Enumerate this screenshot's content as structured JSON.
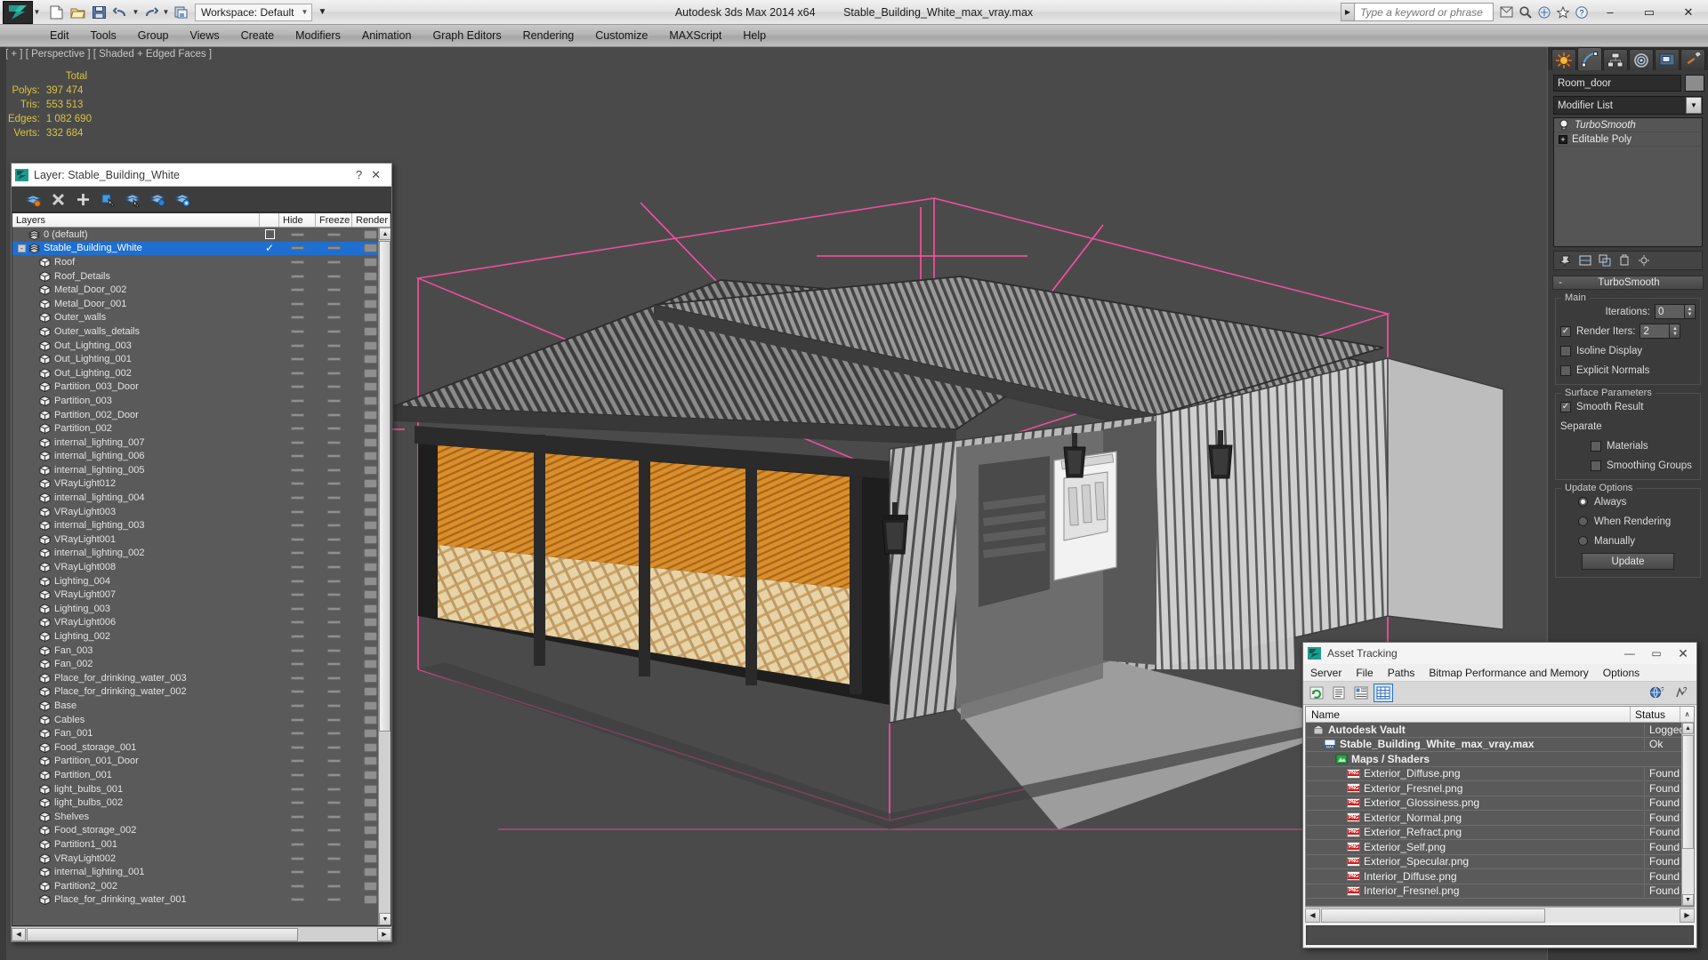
{
  "app": {
    "title": "Autodesk 3ds Max  2014 x64",
    "file": "Stable_Building_White_max_vray.max",
    "workspace": "Workspace: Default",
    "search_placeholder": "Type a keyword or phrase"
  },
  "menu": [
    "Edit",
    "Tools",
    "Group",
    "Views",
    "Create",
    "Modifiers",
    "Animation",
    "Graph Editors",
    "Rendering",
    "Customize",
    "MAXScript",
    "Help"
  ],
  "window_buttons": {
    "minimize": "–",
    "maximize": "▭",
    "close": "✕"
  },
  "viewport": {
    "label": "[ + ] [ Perspective ] [ Shaded + Edged Faces ]",
    "stats_header": "Total",
    "stats": [
      {
        "label": "Polys:",
        "value": "397 474"
      },
      {
        "label": "Tris:",
        "value": "553 513"
      },
      {
        "label": "Edges:",
        "value": "1 082 690"
      },
      {
        "label": "Verts:",
        "value": "332 684"
      }
    ]
  },
  "layer_dialog": {
    "title": "Layer: Stable_Building_White",
    "help_glyph": "?",
    "close_glyph": "✕",
    "toolbar": [
      "delete-layer-icon",
      "remove-layer-icon",
      "new-layer-icon",
      "select-objects-icon",
      "add-selection-icon",
      "select-highlight-icon",
      "layer-properties-icon"
    ],
    "columns": [
      "Layers",
      "",
      "Hide",
      "Freeze",
      "Render"
    ],
    "rows": [
      {
        "name": "0 (default)",
        "indent": 1,
        "type": "layer",
        "checkbox": "empty"
      },
      {
        "name": "Stable_Building_White",
        "indent": 0,
        "type": "layer",
        "checkbox": "tick",
        "selected": true,
        "expander": "-"
      },
      {
        "name": "Roof",
        "indent": 2,
        "type": "object"
      },
      {
        "name": "Roof_Details",
        "indent": 2,
        "type": "object"
      },
      {
        "name": "Metal_Door_002",
        "indent": 2,
        "type": "object"
      },
      {
        "name": "Metal_Door_001",
        "indent": 2,
        "type": "object"
      },
      {
        "name": "Outer_walls",
        "indent": 2,
        "type": "object"
      },
      {
        "name": "Outer_walls_details",
        "indent": 2,
        "type": "object"
      },
      {
        "name": "Out_Lighting_003",
        "indent": 2,
        "type": "object"
      },
      {
        "name": "Out_Lighting_001",
        "indent": 2,
        "type": "object"
      },
      {
        "name": "Out_Lighting_002",
        "indent": 2,
        "type": "object"
      },
      {
        "name": "Partition_003_Door",
        "indent": 2,
        "type": "object"
      },
      {
        "name": "Partition_003",
        "indent": 2,
        "type": "object"
      },
      {
        "name": "Partition_002_Door",
        "indent": 2,
        "type": "object"
      },
      {
        "name": "Partition_002",
        "indent": 2,
        "type": "object"
      },
      {
        "name": "internal_lighting_007",
        "indent": 2,
        "type": "object"
      },
      {
        "name": "internal_lighting_006",
        "indent": 2,
        "type": "object"
      },
      {
        "name": "internal_lighting_005",
        "indent": 2,
        "type": "object"
      },
      {
        "name": "VRayLight012",
        "indent": 2,
        "type": "object"
      },
      {
        "name": "internal_lighting_004",
        "indent": 2,
        "type": "object"
      },
      {
        "name": "VRayLight003",
        "indent": 2,
        "type": "object"
      },
      {
        "name": "internal_lighting_003",
        "indent": 2,
        "type": "object"
      },
      {
        "name": "VRayLight001",
        "indent": 2,
        "type": "object"
      },
      {
        "name": "internal_lighting_002",
        "indent": 2,
        "type": "object"
      },
      {
        "name": "VRayLight008",
        "indent": 2,
        "type": "object"
      },
      {
        "name": "Lighting_004",
        "indent": 2,
        "type": "object"
      },
      {
        "name": "VRayLight007",
        "indent": 2,
        "type": "object"
      },
      {
        "name": "Lighting_003",
        "indent": 2,
        "type": "object"
      },
      {
        "name": "VRayLight006",
        "indent": 2,
        "type": "object"
      },
      {
        "name": "Lighting_002",
        "indent": 2,
        "type": "object"
      },
      {
        "name": "Fan_003",
        "indent": 2,
        "type": "object"
      },
      {
        "name": "Fan_002",
        "indent": 2,
        "type": "object"
      },
      {
        "name": "Place_for_drinking_water_003",
        "indent": 2,
        "type": "object"
      },
      {
        "name": "Place_for_drinking_water_002",
        "indent": 2,
        "type": "object"
      },
      {
        "name": "Base",
        "indent": 2,
        "type": "object"
      },
      {
        "name": "Cables",
        "indent": 2,
        "type": "object"
      },
      {
        "name": "Fan_001",
        "indent": 2,
        "type": "object"
      },
      {
        "name": "Food_storage_001",
        "indent": 2,
        "type": "object"
      },
      {
        "name": "Partition_001_Door",
        "indent": 2,
        "type": "object"
      },
      {
        "name": "Partition_001",
        "indent": 2,
        "type": "object"
      },
      {
        "name": "light_bulbs_001",
        "indent": 2,
        "type": "object"
      },
      {
        "name": "light_bulbs_002",
        "indent": 2,
        "type": "object"
      },
      {
        "name": "Shelves",
        "indent": 2,
        "type": "object"
      },
      {
        "name": "Food_storage_002",
        "indent": 2,
        "type": "object"
      },
      {
        "name": "Partition1_001",
        "indent": 2,
        "type": "object"
      },
      {
        "name": "VRayLight002",
        "indent": 2,
        "type": "object"
      },
      {
        "name": "internal_lighting_001",
        "indent": 2,
        "type": "object"
      },
      {
        "name": "Partition2_002",
        "indent": 2,
        "type": "object"
      },
      {
        "name": "Place_for_drinking_water_001",
        "indent": 2,
        "type": "object"
      }
    ]
  },
  "command_panel": {
    "tabs": [
      "create-tab-icon",
      "modify-tab-icon",
      "hierarchy-tab-icon",
      "motion-tab-icon",
      "display-tab-icon",
      "utilities-tab-icon"
    ],
    "active_tab_index": 1,
    "object_name": "Room_door",
    "modifier_list_label": "Modifier List",
    "modifier_stack": [
      {
        "label": "TurboSmooth",
        "active": true
      },
      {
        "label": "Editable Poly",
        "active": false
      }
    ],
    "stack_buttons": [
      "pin-stack-icon",
      "show-end-result-icon",
      "make-unique-icon",
      "remove-modifier-icon",
      "configure-sets-icon"
    ],
    "rollout": {
      "title": "TurboSmooth",
      "collapse_glyph": "-",
      "groups": [
        {
          "label": "Main",
          "fields": [
            {
              "kind": "spinner",
              "label": "Iterations:",
              "value": "0"
            },
            {
              "kind": "checkbox-spinner",
              "label": "Render Iters:",
              "value": "2",
              "checked": true
            },
            {
              "kind": "checkbox",
              "label": "Isoline Display",
              "checked": false
            },
            {
              "kind": "checkbox",
              "label": "Explicit Normals",
              "checked": false
            }
          ]
        },
        {
          "label": "Surface Parameters",
          "fields": [
            {
              "kind": "checkbox",
              "label": "Smooth Result",
              "checked": true
            },
            {
              "kind": "text",
              "label": "Separate"
            },
            {
              "kind": "checkbox-indent",
              "label": "Materials",
              "checked": false
            },
            {
              "kind": "checkbox-indent",
              "label": "Smoothing Groups",
              "checked": false
            }
          ]
        },
        {
          "label": "Update Options",
          "fields": [
            {
              "kind": "radio",
              "label": "Always",
              "checked": true
            },
            {
              "kind": "radio",
              "label": "When Rendering",
              "checked": false
            },
            {
              "kind": "radio",
              "label": "Manually",
              "checked": false
            },
            {
              "kind": "button",
              "label": "Update"
            }
          ]
        }
      ]
    }
  },
  "asset_tracking": {
    "title": "Asset Tracking",
    "menu": [
      "Server",
      "File",
      "Paths",
      "Bitmap Performance and Memory",
      "Options"
    ],
    "toolbar": [
      "refresh-icon",
      "list-view-icon",
      "details-view-icon",
      "grid-view-icon"
    ],
    "toolbar_right": [
      "help-globe-icon",
      "help-question-icon"
    ],
    "columns": [
      "Name",
      "Status"
    ],
    "sort_glyph": "∧",
    "rows": [
      {
        "name": "Autodesk Vault",
        "status": "Logged",
        "indent": 0,
        "icon": "vault-icon"
      },
      {
        "name": "Stable_Building_White_max_vray.max",
        "status": "Ok",
        "indent": 1,
        "icon": "max-file-icon"
      },
      {
        "name": "Maps / Shaders",
        "status": "",
        "indent": 2,
        "icon": "maps-shaders-icon"
      },
      {
        "name": "Exterior_Diffuse.png",
        "status": "Found",
        "indent": 3,
        "icon": "png-icon"
      },
      {
        "name": "Exterior_Fresnel.png",
        "status": "Found",
        "indent": 3,
        "icon": "png-icon"
      },
      {
        "name": "Exterior_Glossiness.png",
        "status": "Found",
        "indent": 3,
        "icon": "png-icon"
      },
      {
        "name": "Exterior_Normal.png",
        "status": "Found",
        "indent": 3,
        "icon": "png-icon"
      },
      {
        "name": "Exterior_Refract.png",
        "status": "Found",
        "indent": 3,
        "icon": "png-icon"
      },
      {
        "name": "Exterior_Self.png",
        "status": "Found",
        "indent": 3,
        "icon": "png-icon"
      },
      {
        "name": "Exterior_Specular.png",
        "status": "Found",
        "indent": 3,
        "icon": "png-icon"
      },
      {
        "name": "Interior_Diffuse.png",
        "status": "Found",
        "indent": 3,
        "icon": "png-icon"
      },
      {
        "name": "Interior_Fresnel.png",
        "status": "Found",
        "indent": 3,
        "icon": "png-icon"
      }
    ],
    "window_buttons": {
      "minimize": "—",
      "maximize": "▭",
      "close": "✕"
    }
  },
  "colors": {
    "accent_yellow": "#d7c43c",
    "selection_blue": "#1f6fd0",
    "gizmo_pink": "#ff4fa3",
    "viewport_bg": "#4a4a4a",
    "panel_bg": "#3b3b3b"
  }
}
